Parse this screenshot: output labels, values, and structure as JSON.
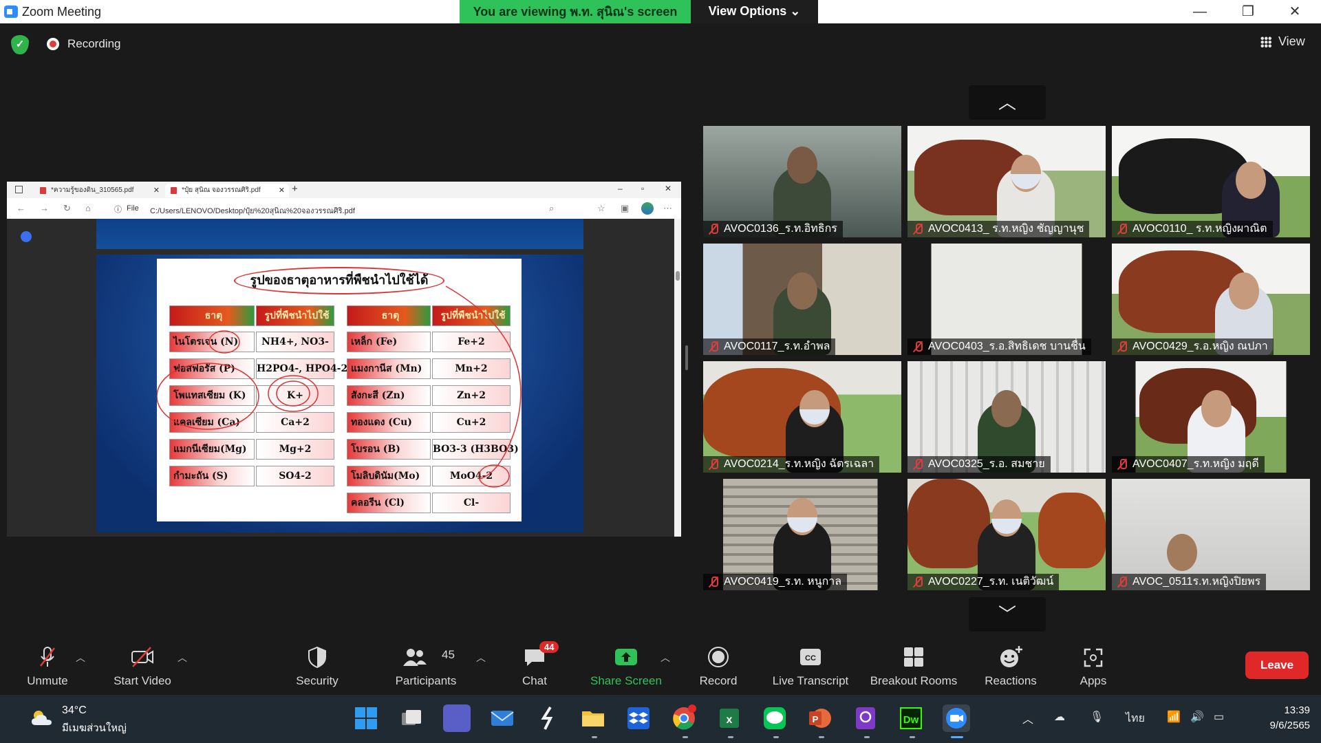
{
  "window": {
    "title": "Zoom Meeting",
    "viewing_banner": "You are viewing พ.ท. สุนิณ's screen",
    "view_options": "View Options ⌄",
    "minimize": "—",
    "maximize": "❐",
    "close": "✕"
  },
  "meeting": {
    "recording_label": "Recording",
    "view_label": "View"
  },
  "browser": {
    "tabs": [
      {
        "label": "*ความรู้ของดิน_310565.pdf"
      },
      {
        "label": "*ปุ๋ย สุนิณ จองวรรณศิริ.pdf"
      }
    ],
    "file_label": "File",
    "url": "C:/Users/LENOVO/Desktop/ปุ๋ย%20สุนิณ%20จองวรรณศิริ.pdf"
  },
  "slide": {
    "title": "รูปของธาตุอาหารที่พืชนำไปใช้ได้",
    "headers": [
      "ธาตุ",
      "รูปที่พืชนำไปใช้",
      "ธาตุ",
      "รูปที่พืชนำไปใช้"
    ],
    "left_rows": [
      {
        "element": "ไนโตรเจน (N)",
        "form": "NH4+, NO3-"
      },
      {
        "element": "ฟอสฟอรัส (P)",
        "form": "H2PO4-, HPO4-2"
      },
      {
        "element": "โพแทสเซียม (K)",
        "form": "K+"
      },
      {
        "element": "แคลเซียม (Ca)",
        "form": "Ca+2"
      },
      {
        "element": "แมกนีเซียม(Mg)",
        "form": "Mg+2"
      },
      {
        "element": "กำมะถัน (S)",
        "form": "SO4-2"
      }
    ],
    "right_rows": [
      {
        "element": "เหล็ก (Fe)",
        "form": "Fe+2"
      },
      {
        "element": "แมงกานีส (Mn)",
        "form": "Mn+2"
      },
      {
        "element": "สังกะสี (Zn)",
        "form": "Zn+2"
      },
      {
        "element": "ทองแดง (Cu)",
        "form": "Cu+2"
      },
      {
        "element": "โบรอน (B)",
        "form": "BO3-3 (H3BO3)"
      },
      {
        "element": "โมลิบดินัม(Mo)",
        "form": "MoO4-2"
      },
      {
        "element": "คลอรีน (Cl)",
        "form": "Cl-"
      }
    ]
  },
  "participants": [
    {
      "name": "AVOC0136_ร.ท.อิทธิกร"
    },
    {
      "name": "AVOC0413_ ร.ท.หญิง ชัญญานุช"
    },
    {
      "name": "AVOC0110_ ร.ท.หญิงผาณิต"
    },
    {
      "name": "AVOC0117_ร.ท.อำพล"
    },
    {
      "name": "AVOC0403_ร.อ.สิทธิเดช บานชื่น"
    },
    {
      "name": "AVOC0429_ร.อ.หญิง ณปภา"
    },
    {
      "name": "AVOC0214_ร.ท.หญิง ฉัตรเฉลา"
    },
    {
      "name": "AVOC0325_ร.อ. สมชาย"
    },
    {
      "name": "AVOC0407_ร.ท.หญิง มฤดี"
    },
    {
      "name": "AVOC0419_ร.ท. หนูกาล"
    },
    {
      "name": "AVOC0227_ร.ท. เนติวัฒน์"
    },
    {
      "name": "AVOC_0511ร.ท.หญิงปิยพร"
    }
  ],
  "toolbar": {
    "unmute": "Unmute",
    "start_video": "Start Video",
    "security": "Security",
    "participants": "Participants",
    "participants_count": "45",
    "chat": "Chat",
    "chat_badge": "44",
    "share_screen": "Share Screen",
    "record": "Record",
    "live_transcript": "Live Transcript",
    "breakout_rooms": "Breakout Rooms",
    "reactions": "Reactions",
    "apps": "Apps",
    "leave": "Leave"
  },
  "taskbar": {
    "temperature": "34°C",
    "weather_desc": "มีเมฆส่วนใหญ่",
    "language": "ไทย",
    "time": "13:39",
    "date": "9/6/2565",
    "icons": [
      "windows-start-icon",
      "task-view-icon",
      "teams-chat-icon",
      "mail-icon",
      "app-s-icon",
      "file-explorer-icon",
      "dropbox-icon",
      "chrome-icon",
      "excel-icon",
      "line-icon",
      "powerpoint-icon",
      "pdf-reader-icon",
      "dreamweaver-icon",
      "zoom-icon"
    ]
  },
  "colors": {
    "banner_green": "#2fc25b",
    "leave_red": "#e02828",
    "share_green": "#2fc25b",
    "mic_off_red": "#e03c3c"
  }
}
